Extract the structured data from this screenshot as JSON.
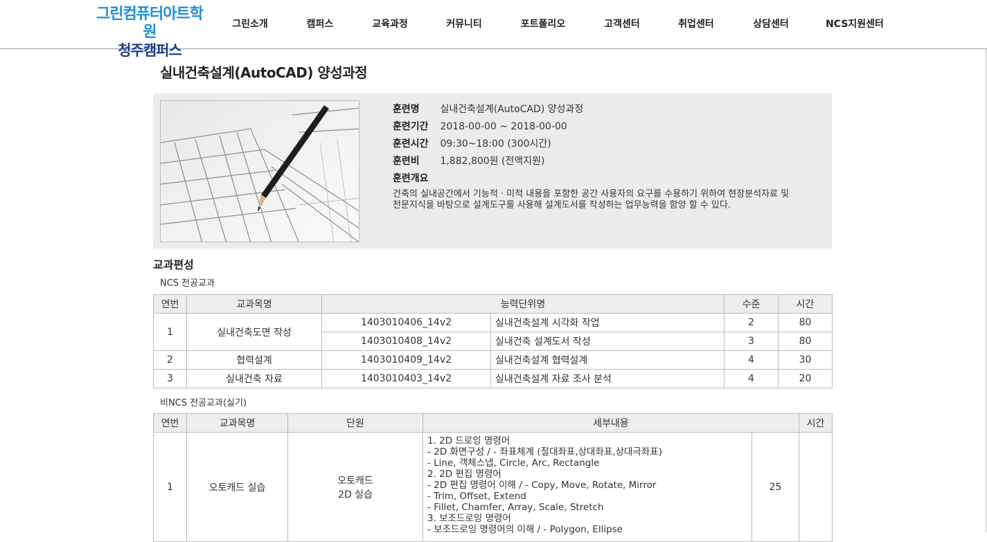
{
  "header": {
    "logo_line1": "그린컴퓨터아트학원",
    "logo_line2": "청주캠퍼스",
    "nav": [
      "그린소개",
      "캠퍼스",
      "교육과정",
      "커뮤니티",
      "포트폴리오",
      "고객센터",
      "취업센터",
      "상담센터",
      "NCS지원센터"
    ]
  },
  "page_title": "실내건축설계(AutoCAD) 양성과정",
  "info": {
    "name_label": "훈련명",
    "name_value": "실내건축설계(AutoCAD) 양성과정",
    "period_label": "훈련기간",
    "period_value": "2018-00-00 ~ 2018-00-00",
    "time_label": "훈련시간",
    "time_value": "09:30~18:00 (300시간)",
    "fee_label": "훈련비",
    "fee_value": "1,882,800원 (전액지원)",
    "summary_label": "훈련개요",
    "summary_line1": "건축의 실내공간에서 기능적 · 미적 내용을 포함한 공간 사용자의 요구를 수용하기 위하여 현장분석자료 및",
    "summary_line2": "전문지식을 바탕으로 설계도구를 사용해 설계도서를 작성하는 업무능력을 함양 할 수 있다."
  },
  "curriculum": {
    "title": "교과편성",
    "ncs": {
      "subtitle": "NCS 전공교과",
      "headers": [
        "연번",
        "교과목명",
        "능력단위명",
        "수준",
        "시간"
      ],
      "rows": [
        {
          "no": "1",
          "subject": "실내건축도면 작성",
          "code": "1403010406_14v2",
          "unit": "실내건축설계 시각화 작업",
          "level": "2",
          "hours": "80"
        },
        {
          "code": "1403010408_14v2",
          "unit": "실내건축 설계도서 작성",
          "level": "3",
          "hours": "80"
        },
        {
          "no": "2",
          "subject": "협력설계",
          "code": "1403010409_14v2",
          "unit": "실내건축설계 협력설계",
          "level": "4",
          "hours": "30"
        },
        {
          "no": "3",
          "subject": "실내건축 자료",
          "code": "1403010403_14v2",
          "unit": "실내건축설계 자료 조사 분석",
          "level": "4",
          "hours": "20"
        }
      ]
    },
    "non_ncs": {
      "subtitle": "비NCS 전공교과(실기)",
      "headers": [
        "연번",
        "교과목명",
        "단원",
        "세부내용",
        "시간"
      ],
      "rows": [
        {
          "no": "1",
          "subject": "오토캐드 실습",
          "unit_line1": "오토캐드",
          "unit_line2": "2D 실습",
          "details": [
            "1. 2D 드로잉 명령어",
            "- 2D 화면구성 / - 좌표체계 (절대좌표,상대좌표,상대극좌표)",
            "- Line, 객체스냅, Circle, Arc, Rectangle",
            "2. 2D 편집 명령어",
            "- 2D 편집 명령어 이해 / - Copy, Move, Rotate, Mirror",
            "- Trim, Offset, Extend",
            "- Fillet, Chamfer, Array, Scale, Stretch",
            "3. 보조드로잉 명령어",
            "- 보조드로잉 명령어의 이해 / - Polygon, Ellipse"
          ],
          "hours": "25"
        }
      ]
    }
  }
}
